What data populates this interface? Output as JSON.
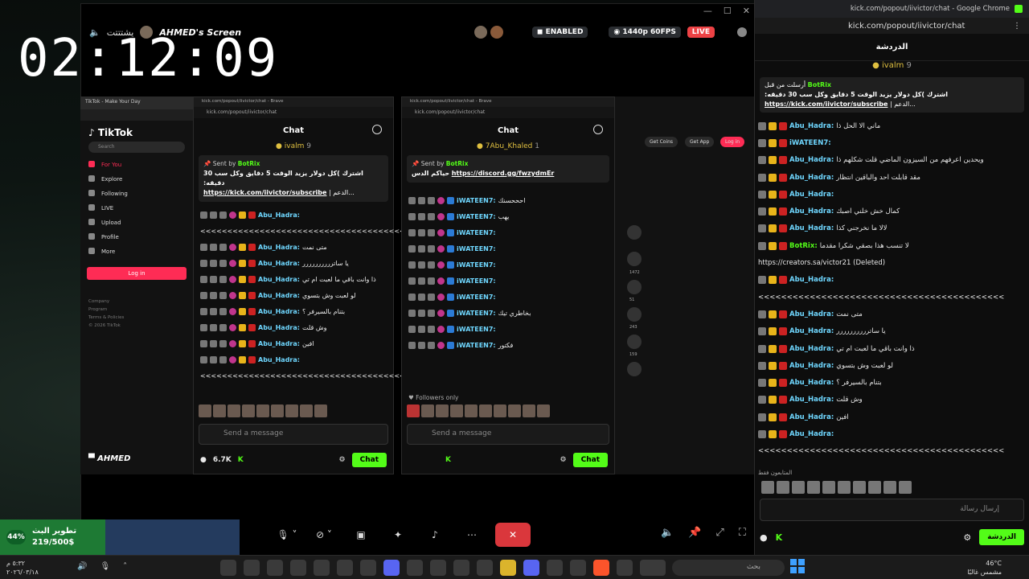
{
  "overlay": {
    "clock": "02:12:09",
    "goal": {
      "percent_label": "44%",
      "title": "تطوير البث",
      "amount": "219/500$",
      "fraction": 0.44
    }
  },
  "share": {
    "speaker_label": "يشتتتت",
    "owner_label": "AHMED's Screen",
    "badge_enabled": "ENABLED",
    "quality": "1440p 60FPS",
    "live": "LIVE",
    "footer_name": "AHMED"
  },
  "tiktok": {
    "tab": "TikTok - Make Your Day",
    "logo": "TikTok",
    "search": "Search",
    "nav": [
      "For You",
      "Explore",
      "Following",
      "LIVE",
      "Upload",
      "Profile",
      "More"
    ],
    "login": "Log in",
    "footer": [
      "Company",
      "Program",
      "Terms & Policies",
      "© 2026 TikTok"
    ],
    "get_coins": "Get Coins",
    "get_app": "Get App",
    "login2": "Log in",
    "counts": [
      "1472",
      "51",
      "243",
      "159"
    ]
  },
  "panel_left": {
    "title_bar": "kick.com/popout/iivictor/chat - Brave",
    "url": "kick.com/popout/iivictor/chat",
    "header": "Chat",
    "top_gifter": "ivalm",
    "top_gifter_count": "9",
    "pinned_by": "Sent by",
    "pinned_bot": "BotRix",
    "pinned_text": "اشترك )كل دولار يزيد الوقت 5 دقايق وكل سب 30 دقيقه:",
    "pinned_link": "https://kick.com/iivictor/subscribe",
    "pinned_suffix": "| الدعم...",
    "messages": [
      {
        "user": "Abu_Hadra:",
        "text": ""
      },
      {
        "user": "",
        "text": "<<<<<<<<<<<<<<<<<<<<<<<<<<<<<<<<<<<<<<<<<<<<<<<<"
      },
      {
        "user": "Abu_Hadra:",
        "text": "متى نمت"
      },
      {
        "user": "Abu_Hadra:",
        "text": "يا ساترررررررررر"
      },
      {
        "user": "Abu_Hadra:",
        "text": "ذا وانت باقي ما لعبت ام تي"
      },
      {
        "user": "Abu_Hadra:",
        "text": "لو لعبت وش بتسوي"
      },
      {
        "user": "Abu_Hadra:",
        "text": "بتنام بالسيرفر ؟"
      },
      {
        "user": "Abu_Hadra:",
        "text": "وش قلت"
      },
      {
        "user": "Abu_Hadra:",
        "text": "افين"
      },
      {
        "user": "Abu_Hadra:",
        "text": ""
      },
      {
        "user": "",
        "text": "<<<<<<<<<<<<<<<<<<<<<<<<<<<<<<<<<<<<<<<<<<<<<<<<"
      }
    ],
    "input_placeholder": "Send a message",
    "viewers": "6.7K",
    "chat_button": "Chat"
  },
  "panel_right": {
    "title_bar": "kick.com/popout/iivictor/chat - Brave",
    "url": "kick.com/popout/iivictor/chat",
    "header": "Chat",
    "top_gifter": "7Abu_Khaled",
    "top_gifter_count": "1",
    "pinned_by": "Sent by",
    "pinned_bot": "BotRix",
    "pinned_text": "حياكم الدس",
    "pinned_link": "https://discord.gg/fwzydmEr",
    "messages": [
      {
        "user": "iWATEEN7:",
        "text": "احححسنك"
      },
      {
        "user": "iWATEEN7:",
        "text": "يهب"
      },
      {
        "user": "iWATEEN7:",
        "text": ""
      },
      {
        "user": "iWATEEN7:",
        "text": ""
      },
      {
        "user": "iWATEEN7:",
        "text": ""
      },
      {
        "user": "iWATEEN7:",
        "text": ""
      },
      {
        "user": "iWATEEN7:",
        "text": ""
      },
      {
        "user": "iWATEEN7:",
        "text": "بخاطري تيك"
      },
      {
        "user": "iWATEEN7:",
        "text": ""
      },
      {
        "user": "iWATEEN7:",
        "text": "فكتور"
      }
    ],
    "followers_only": "Followers only",
    "input_placeholder": "Send a message",
    "chat_button": "Chat"
  },
  "chrome": {
    "title": "kick.com/popout/iivictor/chat - Google Chrome",
    "url": "kick.com/popout/iivictor/chat",
    "header": "الدردشة",
    "top_gifter": "ivalm",
    "top_gifter_count": "9",
    "pinned_header": "أرسلت من قبل",
    "pinned_bot": "BotRix",
    "pinned_text": "اشترك )كل دولار يزيد الوقت 5 دقايق وكل سب 30 دقيقه:",
    "pinned_link": "https://kick.com/iivictor/subscribe",
    "pinned_suffix": "| الدعم...",
    "messages": [
      {
        "user": "Abu_Hadra:",
        "text": "ماني الا الحل ذا"
      },
      {
        "user": "iWATEEN7:",
        "text": ""
      },
      {
        "user": "Abu_Hadra:",
        "text": "ويحدين اعرفهم من السيزون الماضي قلت شكلهم ذا"
      },
      {
        "user": "Abu_Hadra:",
        "text": "مقد قابلت احد والباقين انتظار"
      },
      {
        "user": "Abu_Hadra:",
        "text": ""
      },
      {
        "user": "Abu_Hadra:",
        "text": "كمال خش خلني اصبك"
      },
      {
        "user": "Abu_Hadra:",
        "text": "لالا ما نخرجني كذا"
      },
      {
        "user": "BotRix:",
        "text": "لا تنسب هذا بصقي شكرا مقدما"
      },
      {
        "user": "",
        "text": "https://creators.sa/victor21 (Deleted)"
      },
      {
        "user": "Abu_Hadra:",
        "text": ""
      },
      {
        "user": "",
        "text": "<<<<<<<<<<<<<<<<<<<<<<<<<<<<<<<<<<<<<<<<<<<"
      },
      {
        "user": "Abu_Hadra:",
        "text": "متى نمت"
      },
      {
        "user": "Abu_Hadra:",
        "text": "يا ساترررررررررر"
      },
      {
        "user": "Abu_Hadra:",
        "text": "ذا وانت باقي ما لعبت ام تي"
      },
      {
        "user": "Abu_Hadra:",
        "text": "لو لعبت وش بتسوي"
      },
      {
        "user": "Abu_Hadra:",
        "text": "بتنام بالسيرفر ؟"
      },
      {
        "user": "Abu_Hadra:",
        "text": "وش قلت"
      },
      {
        "user": "Abu_Hadra:",
        "text": "افين"
      },
      {
        "user": "Abu_Hadra:",
        "text": ""
      },
      {
        "user": "",
        "text": "<<<<<<<<<<<<<<<<<<<<<<<<<<<<<<<<<<<<<<<<<<<"
      }
    ],
    "followers_label": "المتابعون فقط",
    "input_placeholder": "إرسال رسالة",
    "chat_button": "الدردشة"
  },
  "taskbar": {
    "time": "٥:٣٢ م",
    "date": "٢٠٢٦/٠٣/١٨",
    "weather_temp": "46°C",
    "weather_desc": "مشمس غالبًا",
    "search": "بحث"
  }
}
